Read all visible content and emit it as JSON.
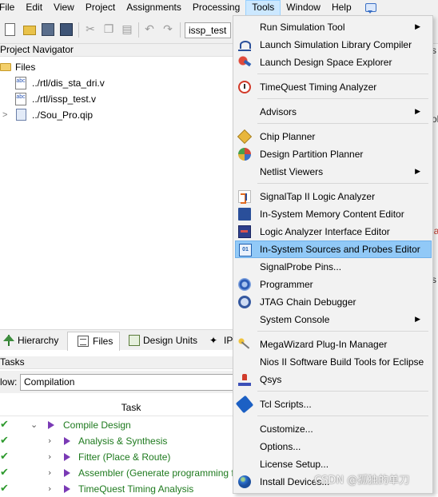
{
  "menubar": {
    "items": [
      "File",
      "Edit",
      "View",
      "Project",
      "Assignments",
      "Processing",
      "Tools",
      "Window",
      "Help"
    ],
    "active": "Tools"
  },
  "toolbar": {
    "project_combo": "issp_test",
    "icons": [
      "new-file-icon",
      "open-folder-icon",
      "save-icon",
      "save-all-icon",
      "cut-icon",
      "copy-icon",
      "paste-icon",
      "undo-icon",
      "redo-icon"
    ]
  },
  "project_navigator": {
    "title": "Project Navigator",
    "folder": "Files",
    "files": [
      "../rtl/dis_sta_dri.v",
      "../rtl/issp_test.v",
      "../Sou_Pro.qip"
    ],
    "file_icon_text": "abc"
  },
  "tabs": {
    "hierarchy": "Hierarchy",
    "files": "Files",
    "design_units": "Design Units",
    "ip": "IP"
  },
  "tasks": {
    "title": "Tasks",
    "flow_label": "low:",
    "flow_value": "Compilation",
    "column_header": "Task",
    "rows": [
      "Compile Design",
      "Analysis & Synthesis",
      "Fitter (Place & Route)",
      "Assembler (Generate programming files)",
      "TimeQuest Timing Analysis"
    ],
    "status_icon": "check-icon"
  },
  "tools_menu": {
    "items": [
      {
        "label": "Run Simulation Tool",
        "submenu": true
      },
      {
        "label": "Launch Simulation Library Compiler",
        "submenu": false
      },
      {
        "label": "Launch Design Space Explorer",
        "submenu": false
      },
      {
        "label": "TimeQuest Timing Analyzer",
        "submenu": false
      },
      {
        "label": "Advisors",
        "submenu": true
      },
      {
        "label": "Chip Planner",
        "submenu": false
      },
      {
        "label": "Design Partition Planner",
        "submenu": false
      },
      {
        "label": "Netlist Viewers",
        "submenu": true
      },
      {
        "label": "SignalTap II Logic Analyzer",
        "submenu": false
      },
      {
        "label": "In-System Memory Content Editor",
        "submenu": false
      },
      {
        "label": "Logic Analyzer Interface Editor",
        "submenu": false
      },
      {
        "label": "In-System Sources and Probes Editor",
        "submenu": false
      },
      {
        "label": "SignalProbe Pins...",
        "submenu": false
      },
      {
        "label": "Programmer",
        "submenu": false
      },
      {
        "label": "JTAG Chain Debugger",
        "submenu": false
      },
      {
        "label": "System Console",
        "submenu": true
      },
      {
        "label": "MegaWizard Plug-In Manager",
        "submenu": false
      },
      {
        "label": "Nios II Software Build Tools for Eclipse",
        "submenu": false
      },
      {
        "label": "Qsys",
        "submenu": false
      },
      {
        "label": "Tcl Scripts...",
        "submenu": false
      },
      {
        "label": "Customize...",
        "submenu": false
      },
      {
        "label": "Options...",
        "submenu": false
      },
      {
        "label": "License Setup...",
        "submenu": false
      },
      {
        "label": "Install Devices...",
        "submenu": false
      }
    ],
    "highlighted": "In-System Sources and Probes Editor",
    "issp_icon_text": "01",
    "submenu_arrow": "▶"
  },
  "right_panel": {
    "fragments": [
      "s",
      "ol",
      "ia",
      "s"
    ]
  },
  "watermark": "CSDN @孤独的单刀",
  "colors": {
    "menu_highlight": "#91c9f7",
    "menubar_active": "#cce8ff",
    "task_text": "#1e7a1e",
    "task_play": "#7a3ab5",
    "check": "#2e9a2e"
  }
}
